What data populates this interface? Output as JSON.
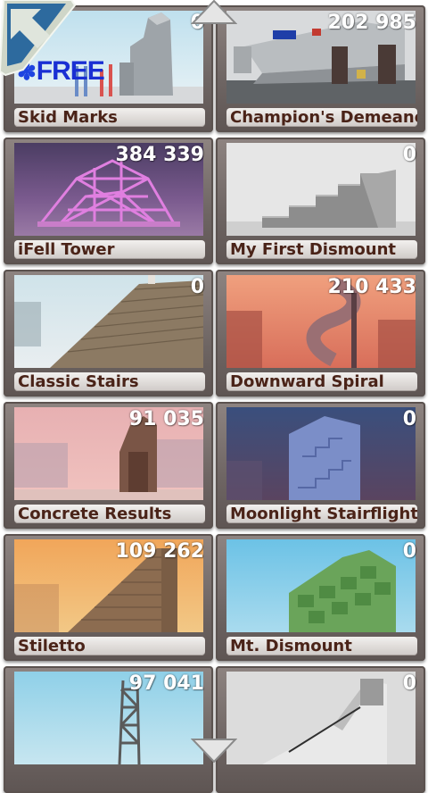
{
  "levels": [
    {
      "name": "Skid Marks",
      "score": "0",
      "icon": "skid-marks-thumbnail",
      "badge": "FREE"
    },
    {
      "name": "Champion's Demeanor",
      "score": "202 985",
      "icon": "champions-demeanor-thumbnail"
    },
    {
      "name": "iFell Tower",
      "score": "384 339",
      "icon": "ifell-tower-thumbnail"
    },
    {
      "name": "My First Dismount",
      "score": "0",
      "icon": "my-first-dismount-thumbnail"
    },
    {
      "name": "Classic Stairs",
      "score": "0",
      "icon": "classic-stairs-thumbnail"
    },
    {
      "name": "Downward Spiral",
      "score": "210 433",
      "icon": "downward-spiral-thumbnail"
    },
    {
      "name": "Concrete Results",
      "score": "91 035",
      "icon": "concrete-results-thumbnail"
    },
    {
      "name": "Moonlight Stairflight",
      "score": "0",
      "icon": "moonlight-stairflight-thumbnail"
    },
    {
      "name": "Stiletto",
      "score": "109 262",
      "icon": "stiletto-thumbnail"
    },
    {
      "name": "Mt. Dismount",
      "score": "0",
      "icon": "mt-dismount-thumbnail"
    },
    {
      "name": "",
      "score": "97 041",
      "icon": "scaffold-tower-thumbnail"
    },
    {
      "name": "",
      "score": "0",
      "icon": "ramp-building-thumbnail"
    }
  ],
  "icons": {
    "back": "back-arrow-icon",
    "scroll_up": "scroll-up-arrow-icon",
    "scroll_down": "scroll-down-arrow-icon",
    "free_flower": "flower-icon"
  },
  "colors": {
    "card_frame": "#7a706d",
    "label_bg": "#e6e3e0",
    "label_text": "#4a2318",
    "score_text": "#ffffff",
    "free_badge": "#1a2fd3",
    "back_button": "#2f6fa3"
  }
}
